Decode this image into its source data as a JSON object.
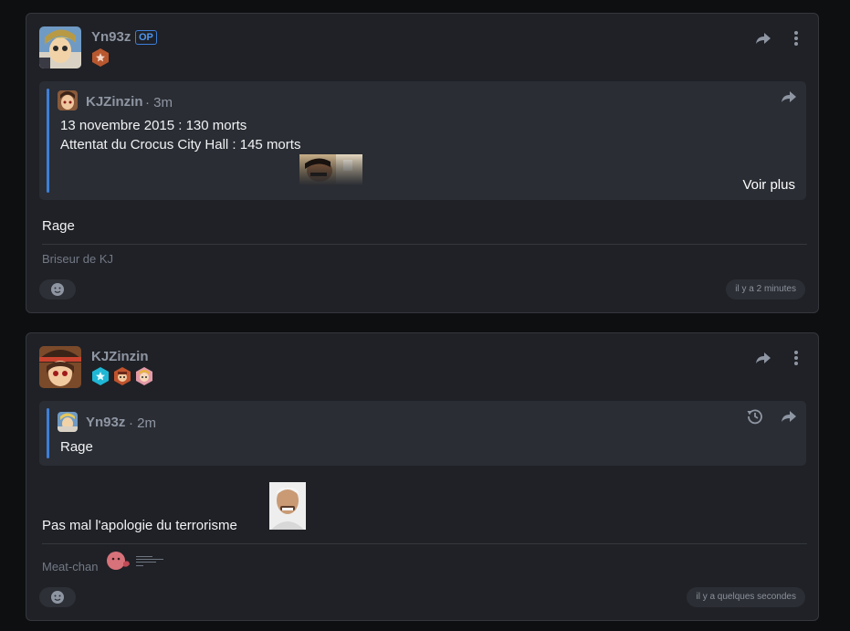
{
  "posts": [
    {
      "author": "Yn93z",
      "op_label": "OP",
      "badges": [
        "bronze-star-badge"
      ],
      "quote": {
        "author": "KJZinzin",
        "time": "· 3m",
        "lines": [
          "13 novembre 2015 : 130 morts",
          "Attentat du Crocus City Hall : 145 morts"
        ],
        "more_label": "Voir plus"
      },
      "text": "Rage",
      "signature": "Briseur de KJ",
      "timestamp": "il y a 2 minutes"
    },
    {
      "author": "KJZinzin",
      "badges": [
        "cyan-star-badge",
        "orange-character-badge",
        "pink-character-badge"
      ],
      "quote": {
        "author": "Yn93z",
        "time": "· 2m",
        "lines": [
          "Rage"
        ]
      },
      "text": "Pas mal l'apologie du terrorisme",
      "signature": "Meat-chan",
      "timestamp": "il y a quelques secondes"
    }
  ],
  "colors": {
    "background": "#0e0f11",
    "card": "#1f2126",
    "quote_bg": "#2a2d33",
    "accent_blue": "#3f7fd6",
    "muted_text": "#8f96a3"
  }
}
